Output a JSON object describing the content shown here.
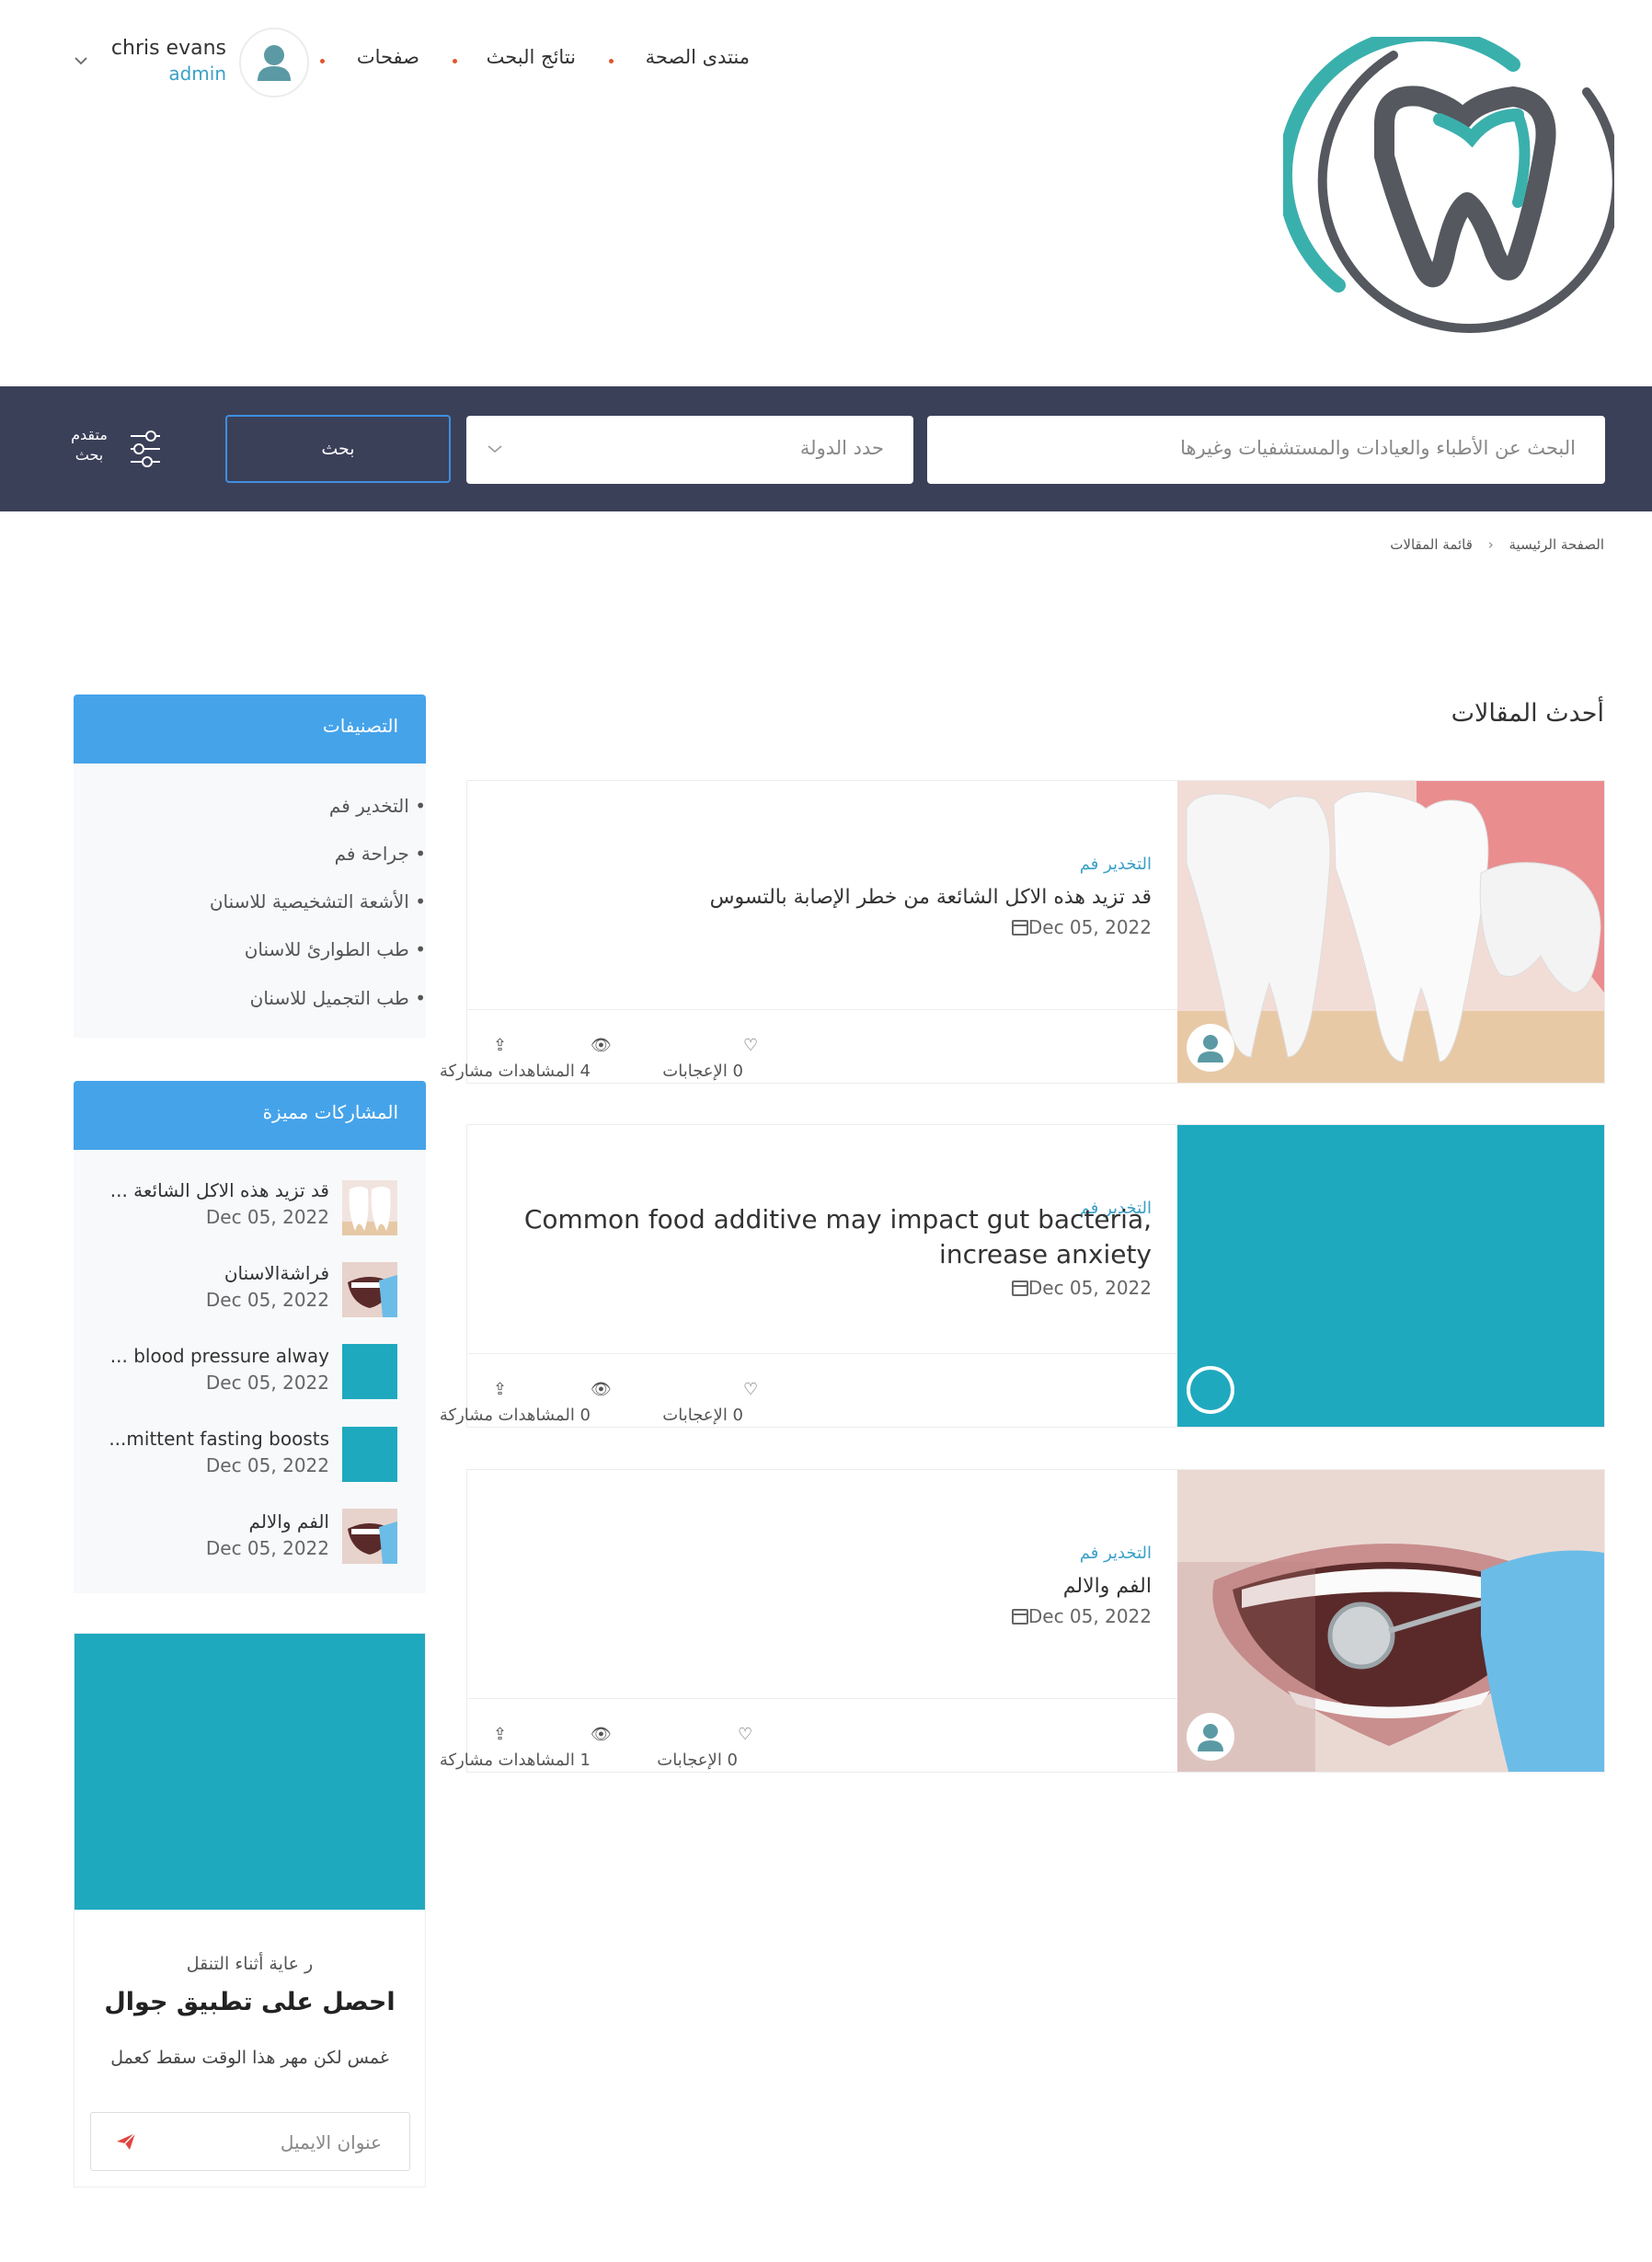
{
  "header": {
    "nav": [
      "منتدى الصحة",
      "نتائج البحث",
      "صفحات"
    ],
    "user": {
      "name": "chris evans",
      "role": "admin"
    },
    "logo_icon": "tooth-logo"
  },
  "search": {
    "main_placeholder": "البحث عن الأطباء والعيادات والمستشفيات وغيرها",
    "country_placeholder": "حدد الدولة",
    "button_label": "بحث",
    "advanced_label_line1": "متقدم",
    "advanced_label_line2": "بحث"
  },
  "breadcrumb": {
    "home": "الصفحة الرئيسية",
    "current": "قائمة المقالات"
  },
  "articles": {
    "section_title": "أحدث المقالات",
    "items": [
      {
        "category": "التخدير فم",
        "title": "قد تزيد هذه الاكل الشائعة من خطر الإصابة بالتسوس",
        "date": "Dec 05, 2022",
        "likes": "0 الإعجابات",
        "views": "4 المشاهدات",
        "share": "مشاركة"
      },
      {
        "category": "التخدير فم",
        "title": "Common food additive may impact gut bacteria, increase anxiety",
        "date": "Dec 05, 2022",
        "likes": "0 الإعجابات",
        "views": "0 المشاهدات",
        "share": "مشاركة"
      },
      {
        "category": "التخدير فم",
        "title": "الفم والالم",
        "date": "Dec 05, 2022",
        "likes": "0 الإعجابات",
        "views": "1 المشاهدات",
        "share": "مشاركة"
      }
    ]
  },
  "sidebar": {
    "categories_title": "التصنيفات",
    "categories": [
      "التخدير فم",
      "جراحة فم",
      "الأشعة التشخيصية للاسنان",
      "طب الطوارئ للاسنان",
      "طب التجميل للاسنان"
    ],
    "featured_title": "المشاركات مميزة",
    "featured": [
      {
        "title": "قد تزيد هذه الاكل الشائعة ...",
        "date": "Dec 05, 2022"
      },
      {
        "title": "فراشةالاسنان",
        "date": "Dec 05, 2022"
      },
      {
        "title": "... blood pressure alway",
        "date": "Dec 05, 2022"
      },
      {
        "title": "...mittent fasting boosts",
        "date": "Dec 05, 2022"
      },
      {
        "title": "الفم والالم",
        "date": "Dec 05, 2022"
      }
    ],
    "app": {
      "subtitle": "ر عاية أثناء التنقل",
      "title": "احصل على تطبيق جوال",
      "text": "غمس لكن مهر هذا الوقت سقط كعمل",
      "email_placeholder": "عنوان الايميل"
    }
  },
  "colors": {
    "dark_bar": "#3b4059",
    "accent_blue": "#45a3ea",
    "teal": "#1fa9bf",
    "link": "#3aa0c7"
  }
}
